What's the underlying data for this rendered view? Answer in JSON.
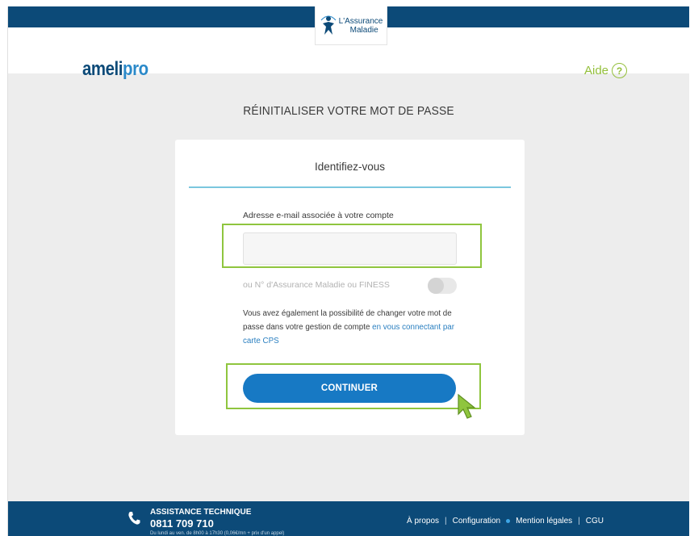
{
  "header": {
    "brand_part1": "ameli",
    "brand_part2": "pro",
    "assurance_line1": "L'Assurance",
    "assurance_line2": "Maladie",
    "help_label": "Aide",
    "help_icon_glyph": "?"
  },
  "page": {
    "title": "RÉINITIALISER VOTRE MOT DE PASSE"
  },
  "card": {
    "title": "Identifiez-vous",
    "email_label": "Adresse e-mail associée à votre compte",
    "email_value": "",
    "alt_label": "ou N° d'Assurance Maladie ou FINESS",
    "alt_toggle_on": false,
    "info_text": "Vous avez également la possibilité de changer votre mot de passe dans votre gestion de compte ",
    "info_link": "en vous connectant par carte CPS",
    "continue_label": "CONTINUER"
  },
  "footer": {
    "assist_title": "ASSISTANCE TECHNIQUE",
    "assist_phone": "0811 709 710",
    "assist_note": "Du lundi au ven. de 8h00 à 17h30 (0,06€/mn + prix d'un appel)",
    "links": [
      "À propos",
      "Configuration",
      "Mention légales",
      "CGU"
    ]
  },
  "colors": {
    "navy": "#0c4a78",
    "accent_blue": "#1779c4",
    "highlight_green": "#8fc53e",
    "background": "#ededed"
  }
}
